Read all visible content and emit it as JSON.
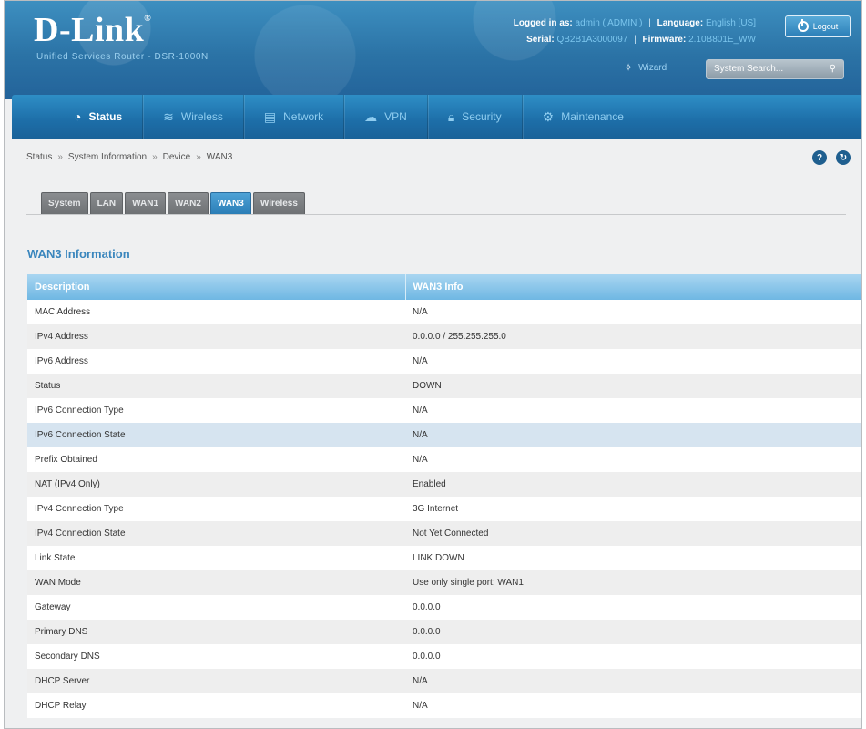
{
  "brand": {
    "logo": "D-Link",
    "subtitle": "Unified Services Router - DSR-1000N"
  },
  "header": {
    "logged_in_label": "Logged in as:",
    "logged_in_value": "admin ( ADMIN )",
    "language_label": "Language:",
    "language_value": "English [US]",
    "serial_label": "Serial:",
    "serial_value": "QB2B1A3000097",
    "firmware_label": "Firmware:",
    "firmware_value": "2.10B801E_WW",
    "logout_label": "Logout",
    "wizard_label": "Wizard",
    "search_placeholder": "System Search...",
    "icons": {
      "logout": "power-icon",
      "wizard": "wand-icon",
      "search": "search-icon"
    }
  },
  "nav": [
    {
      "label": "Status",
      "icon": "gauge-icon"
    },
    {
      "label": "Wireless",
      "icon": "wifi-icon"
    },
    {
      "label": "Network",
      "icon": "network-icon"
    },
    {
      "label": "VPN",
      "icon": "cloud-icon"
    },
    {
      "label": "Security",
      "icon": "lock-icon"
    },
    {
      "label": "Maintenance",
      "icon": "gears-icon"
    }
  ],
  "breadcrumb": [
    "Status",
    "System Information",
    "Device",
    "WAN3"
  ],
  "breadcrumb_sep": "»",
  "tabs": [
    "System",
    "LAN",
    "WAN1",
    "WAN2",
    "WAN3",
    "Wireless"
  ],
  "section_title": "WAN3 Information",
  "table": {
    "headers": [
      "Description",
      "WAN3 Info"
    ],
    "rows": [
      [
        "MAC Address",
        "N/A"
      ],
      [
        "IPv4 Address",
        "0.0.0.0 / 255.255.255.0"
      ],
      [
        "IPv6 Address",
        "N/A"
      ],
      [
        "Status",
        "DOWN"
      ],
      [
        "IPv6 Connection Type",
        "N/A"
      ],
      [
        "IPv6 Connection State",
        "N/A"
      ],
      [
        "Prefix Obtained",
        "N/A"
      ],
      [
        "NAT (IPv4 Only)",
        "Enabled"
      ],
      [
        "IPv4 Connection Type",
        "3G Internet"
      ],
      [
        "IPv4 Connection State",
        "Not Yet Connected"
      ],
      [
        "Link State",
        "LINK DOWN"
      ],
      [
        "WAN Mode",
        "Use only single port: WAN1"
      ],
      [
        "Gateway",
        "0.0.0.0"
      ],
      [
        "Primary DNS",
        "0.0.0.0"
      ],
      [
        "Secondary DNS",
        "0.0.0.0"
      ],
      [
        "DHCP Server",
        "N/A"
      ],
      [
        "DHCP Relay",
        "N/A"
      ]
    ]
  },
  "colors": {
    "accent": "#2b73a6",
    "active_tab": "#3a8fc8",
    "section_title": "#3a86bd"
  }
}
